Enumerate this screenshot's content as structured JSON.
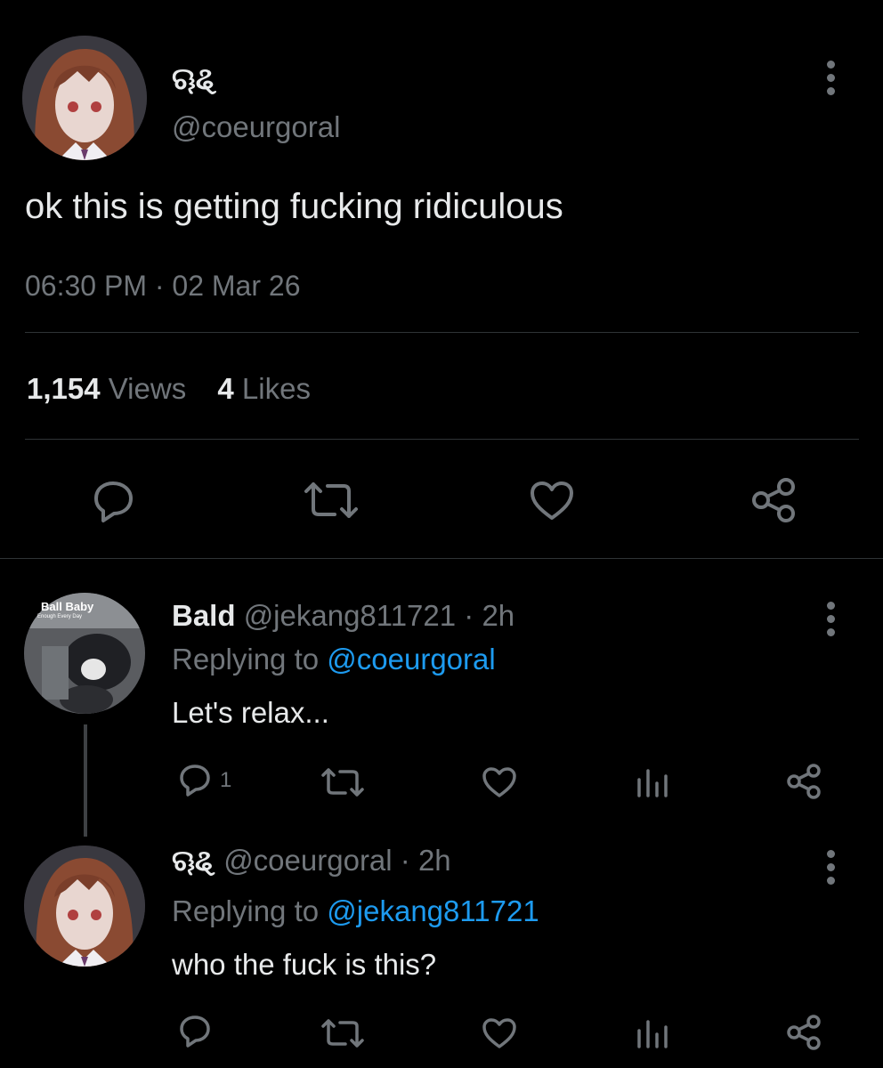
{
  "main_tweet": {
    "display_name": "ୠୡ",
    "handle": "@coeurgoral",
    "text": "ok this is getting fucking ridiculous",
    "time": "06:30 PM",
    "separator": "·",
    "date": "02 Mar 26",
    "views_count": "1,154",
    "views_label": "Views",
    "likes_count": "4",
    "likes_label": "Likes"
  },
  "replies": [
    {
      "avatar_text": "Ball Baby",
      "avatar_subtext": "Enough Every Day",
      "name": "Bald",
      "handle": "@jekang811721",
      "time": "· 2h",
      "replying_prefix": "Replying to",
      "replying_to": "@coeurgoral",
      "text": "Let's relax...",
      "reply_count": "1"
    },
    {
      "name": "ୠୡ",
      "handle": "@coeurgoral",
      "time": "· 2h",
      "replying_prefix": "Replying to",
      "replying_to": "@jekang811721",
      "text": "who the fuck is this?"
    }
  ],
  "icons": [
    "more-icon",
    "reply-icon",
    "retweet-icon",
    "like-icon",
    "share-icon",
    "analytics-icon"
  ],
  "colors": {
    "background": "#000000",
    "text": "#e7e9ea",
    "muted": "#71767b",
    "link": "#1d9bf0",
    "divider": "#2f3336"
  }
}
